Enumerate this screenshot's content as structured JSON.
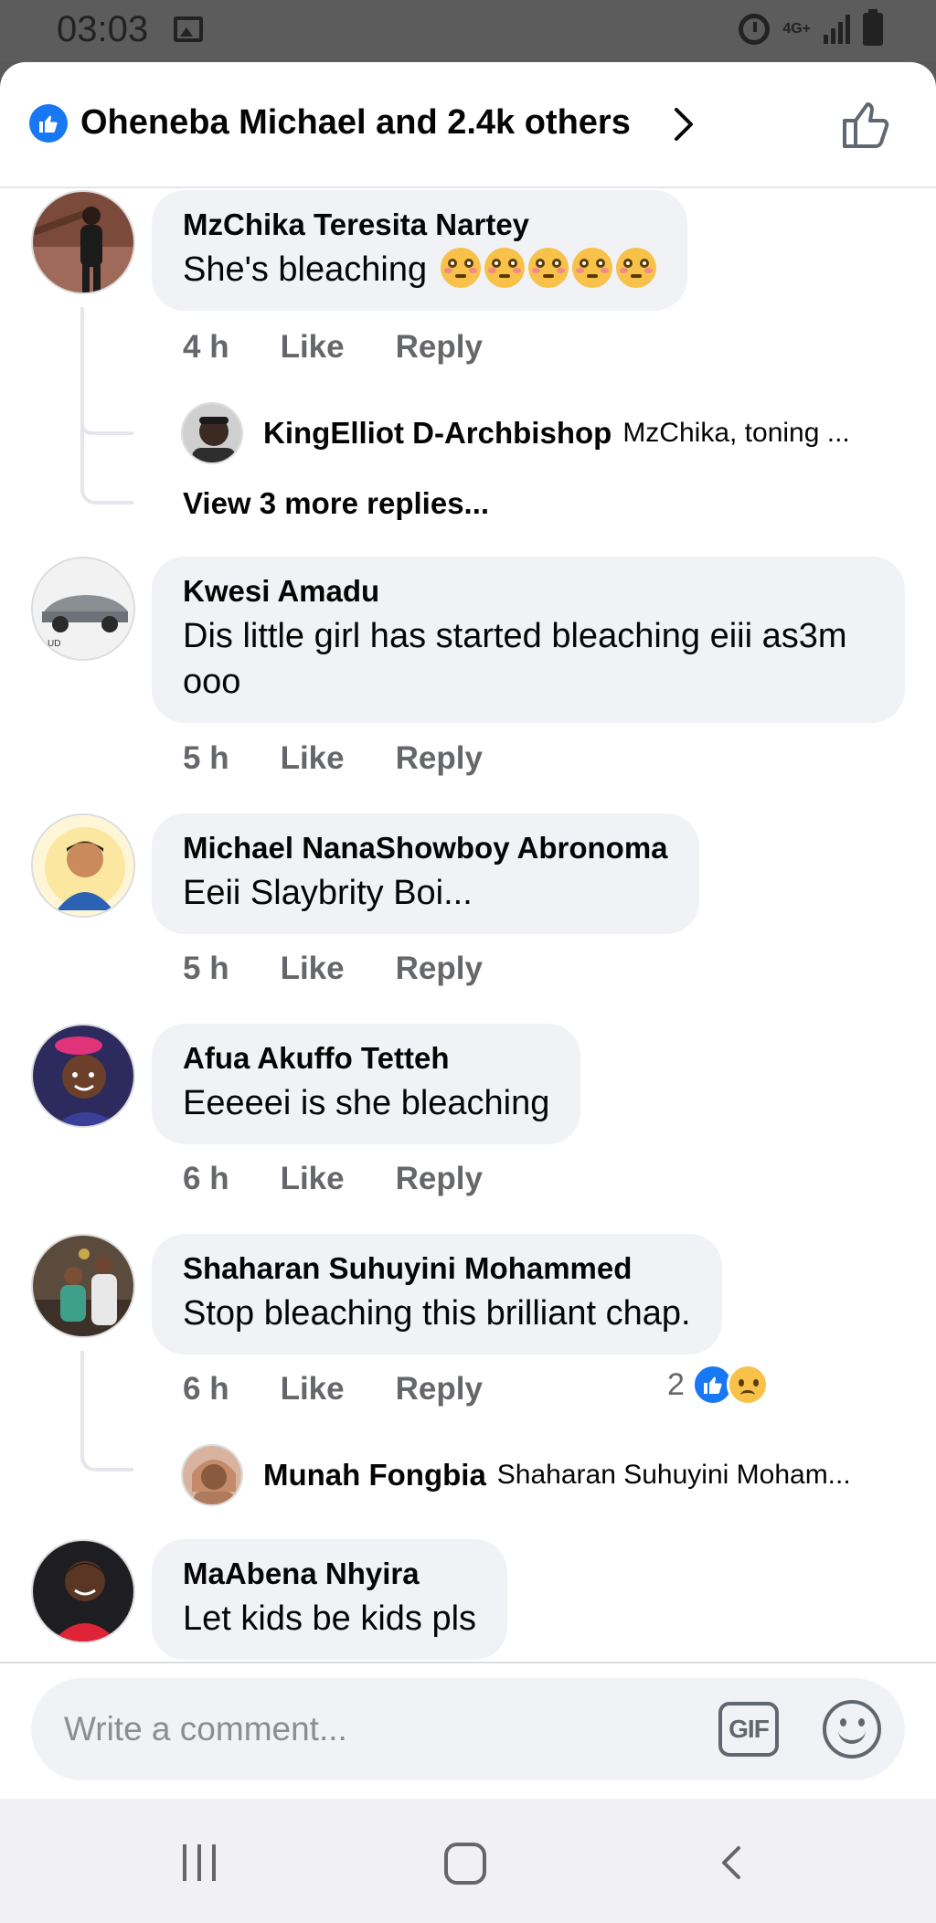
{
  "status_bar": {
    "time": "03:03",
    "network": "4G+"
  },
  "header": {
    "likes_text": "Oheneba Michael and 2.4k others"
  },
  "comments": [
    {
      "author": "MzChika Teresita Nartey",
      "text": "She's bleaching",
      "emoji_count": 5,
      "time": "4 h",
      "like_label": "Like",
      "reply_label": "Reply",
      "reply_preview": {
        "author": "KingElliot D-Archbishop",
        "text": "MzChika, toning ..."
      },
      "more_replies": "View 3 more replies..."
    },
    {
      "author": "Kwesi Amadu",
      "text": "Dis little girl has started bleaching eiii as3m ooo",
      "time": "5 h",
      "like_label": "Like",
      "reply_label": "Reply"
    },
    {
      "author": "Michael NanaShowboy Abronoma",
      "text": "Eeii Slaybrity Boi...",
      "time": "5 h",
      "like_label": "Like",
      "reply_label": "Reply"
    },
    {
      "author": "Afua Akuffo Tetteh",
      "text": "Eeeeei is she bleaching",
      "time": "6 h",
      "like_label": "Like",
      "reply_label": "Reply"
    },
    {
      "author": "Shaharan Suhuyini Mohammed",
      "text": "Stop bleaching this brilliant chap.",
      "time": "6 h",
      "like_label": "Like",
      "reply_label": "Reply",
      "reactions": {
        "count": "2",
        "types": [
          "like-icon",
          "sad-icon"
        ]
      },
      "reply_preview": {
        "author": "Munah Fongbia",
        "text": "Shaharan Suhuyini Moham..."
      }
    },
    {
      "author": "MaAbena Nhyira",
      "text": "Let kids be kids pls"
    }
  ],
  "composer": {
    "placeholder": "Write a comment...",
    "gif_label": "GIF"
  },
  "colors": {
    "accent": "#1877f2",
    "bubble": "#f0f2f5",
    "meta": "#65676b"
  }
}
